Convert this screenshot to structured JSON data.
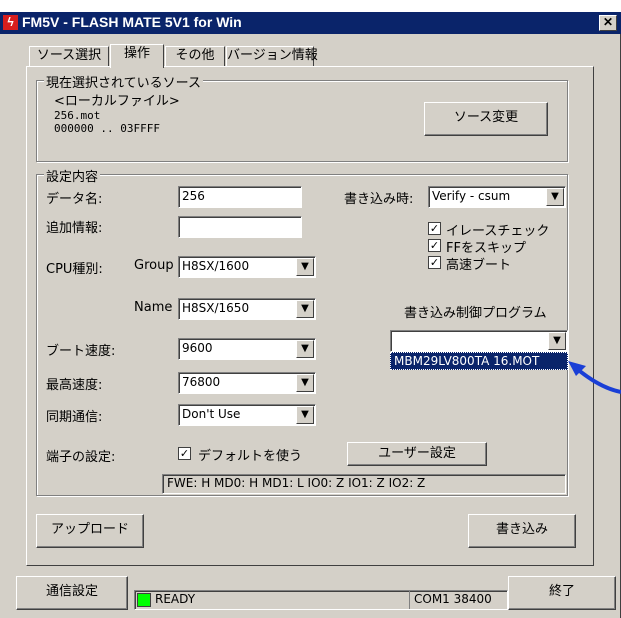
{
  "window": {
    "title": "FM5V - FLASH MATE 5V1 for Win"
  },
  "tabs": [
    "ソース選択",
    "操作",
    "その他",
    "バージョン情報"
  ],
  "source": {
    "group_label": "現在選択されているソース",
    "lines": [
      "<ローカルファイル>",
      "256.mot",
      "000000 .. 03FFFF"
    ],
    "change_button": "ソース変更"
  },
  "settings": {
    "group_label": "設定内容",
    "data_name_label": "データ名:",
    "data_name_value": "256",
    "extra_info_label": "追加情報:",
    "extra_info_value": "",
    "cpu_label": "CPU種別:",
    "group_sub_label": "Group",
    "group_value": "H8SX/1600",
    "name_sub_label": "Name",
    "name_value": "H8SX/1650",
    "boot_speed_label": "ブート速度:",
    "boot_speed_value": "9600",
    "max_speed_label": "最高速度:",
    "max_speed_value": "76800",
    "sync_label": "同期通信:",
    "sync_value": "Don't Use",
    "pin_label": "端子の設定:",
    "default_checkbox": "デフォルトを使う",
    "user_setting_button": "ユーザー設定",
    "pin_status": "FWE: H  MD0: H  MD1: L  IO0: Z  IO1: Z  IO2: Z",
    "write_mode_label": "書き込み時:",
    "write_mode_value": "Verify - csum",
    "erase_check": "イレースチェック",
    "skip_ff": "FFをスキップ",
    "fast_boot": "高速ブート",
    "control_program_label": "書き込み制御プログラム",
    "control_program_value": "",
    "dropdown_option": "MBM29LV800TA 16.MOT"
  },
  "buttons": {
    "upload": "アップロード",
    "write": "書き込み"
  },
  "footer": {
    "comm_settings": "通信設定",
    "status_text": "READY",
    "port_text": "COM1 38400",
    "exit": "終了"
  },
  "colors": {
    "title_bar": "#0a246a",
    "status_led": "#00ff00",
    "arrow": "#1a3fd6",
    "selection": "#0a246a"
  }
}
